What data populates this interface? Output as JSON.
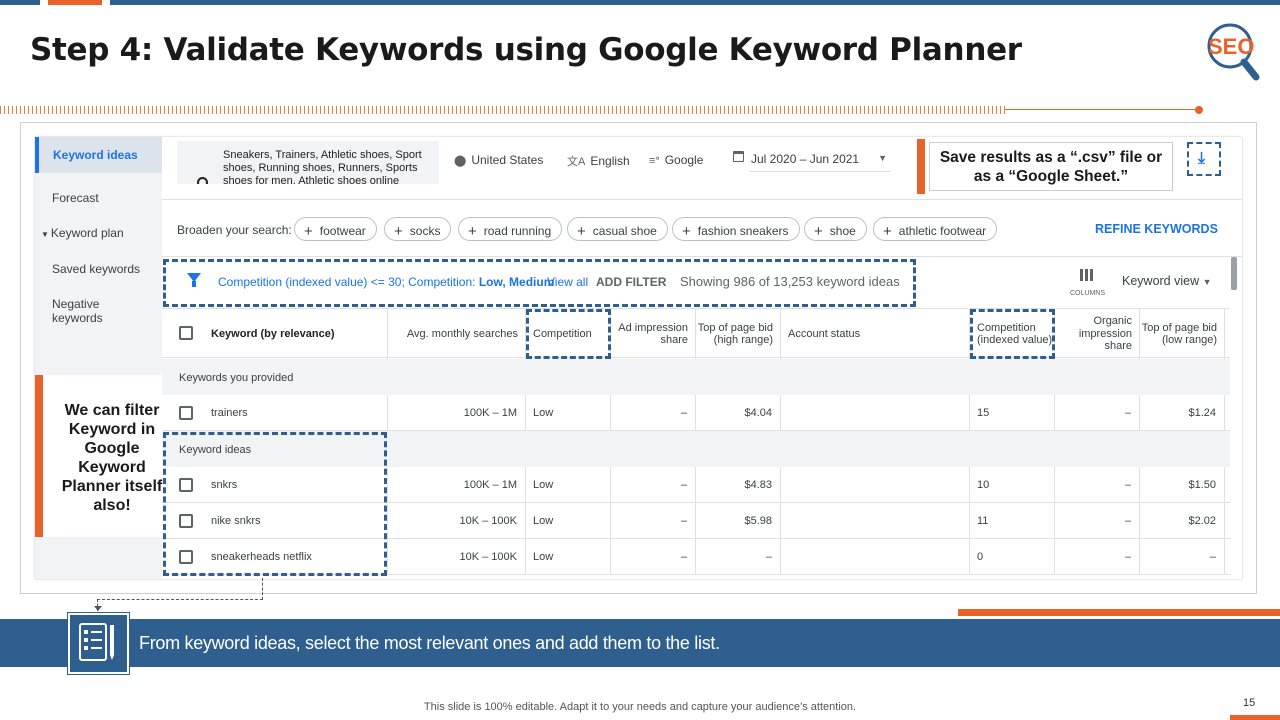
{
  "slide": {
    "title": "Step 4: Validate Keywords using Google Keyword Planner",
    "logo_text": "SEO",
    "page_number": "15",
    "footer": "This slide is 100% editable. Adapt it to your needs and capture your audience’s attention.",
    "banner_text": "From keyword ideas, select the most relevant ones and add them to the list.",
    "filter_note": "We can filter Keyword in Google Keyword Planner itself also!",
    "csv_note": "Save results as a “.csv” file or as a “Google Sheet.”",
    "colors": {
      "accent": "#e8622a",
      "primary": "#2f5f8f",
      "link": "#1a73e8"
    }
  },
  "sidebar": {
    "items": [
      {
        "label": "Keyword ideas",
        "active": true
      },
      {
        "label": "Forecast"
      },
      {
        "label": "Keyword plan"
      },
      {
        "label": "Saved keywords"
      },
      {
        "label": "Negative keywords"
      }
    ]
  },
  "search": {
    "value": "Sneakers, Trainers, Athletic shoes, Sport shoes, Running shoes, Runners, Sports shoes for men, Athletic shoes online",
    "location": "United States",
    "language": "English",
    "network": "Google",
    "date_range": "Jul 2020 – Jun 2021"
  },
  "broaden": {
    "label": "Broaden your search:",
    "chips": [
      "footwear",
      "socks",
      "road running",
      "casual shoe",
      "fashion sneakers",
      "shoe",
      "athletic footwear"
    ],
    "refine": "REFINE KEYWORDS"
  },
  "filterbar": {
    "filter_text": "Competition (indexed value) <= 30;",
    "filter_text2": "Competition:",
    "filter_value2": "Low, Medium",
    "view_all": "View all",
    "add_filter": "ADD FILTER",
    "showing": "Showing 986 of 13,253 keyword ideas",
    "columns_label": "COLUMNS",
    "view": "Keyword view"
  },
  "table": {
    "headers": {
      "keyword": "Keyword (by relevance)",
      "avg": "Avg. monthly searches",
      "competition": "Competition",
      "ad_share": "Ad impression share",
      "top_high": "Top of page bid (high range)",
      "account": "Account status",
      "comp_index": "Competition (indexed value)",
      "organic": "Organic impression share",
      "top_low": "Top of page bid (low range)"
    },
    "group1": "Keywords you provided",
    "group2": "Keyword ideas",
    "rows": [
      {
        "keyword": "trainers",
        "avg": "100K – 1M",
        "competition": "Low",
        "ad_share": "–",
        "top_high": "$4.04",
        "account": "",
        "comp_index": "15",
        "organic": "–",
        "top_low": "$1.24"
      },
      {
        "keyword": "snkrs",
        "avg": "100K – 1M",
        "competition": "Low",
        "ad_share": "–",
        "top_high": "$4.83",
        "account": "",
        "comp_index": "10",
        "organic": "–",
        "top_low": "$1.50"
      },
      {
        "keyword": "nike snkrs",
        "avg": "10K – 100K",
        "competition": "Low",
        "ad_share": "–",
        "top_high": "$5.98",
        "account": "",
        "comp_index": "11",
        "organic": "–",
        "top_low": "$2.02"
      },
      {
        "keyword": "sneakerheads netflix",
        "avg": "10K – 100K",
        "competition": "Low",
        "ad_share": "–",
        "top_high": "–",
        "account": "",
        "comp_index": "0",
        "organic": "–",
        "top_low": "–"
      }
    ]
  }
}
